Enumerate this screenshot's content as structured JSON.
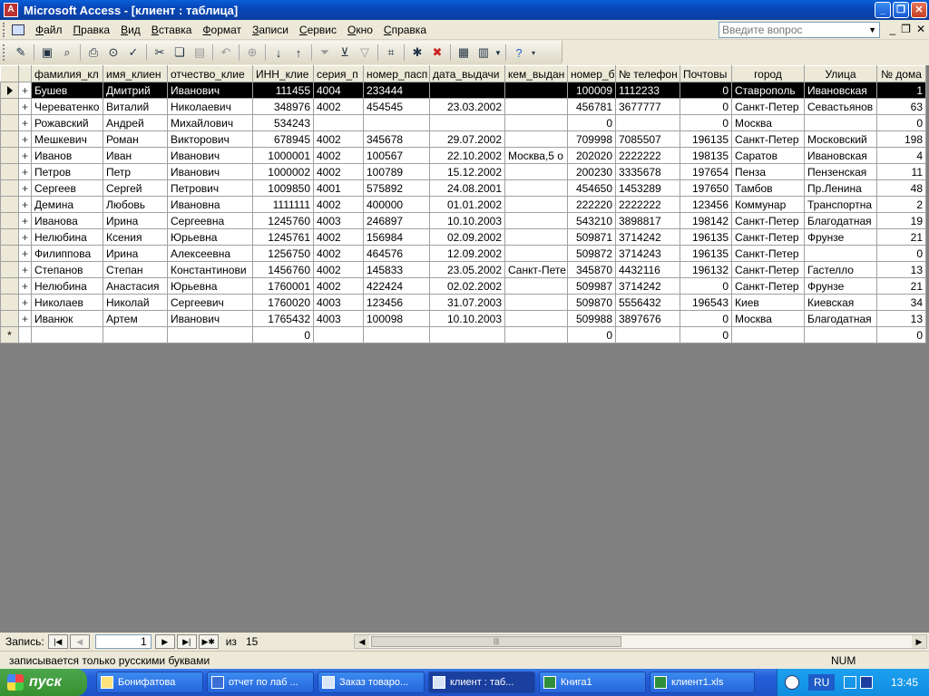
{
  "window": {
    "title": "Microsoft Access - [клиент : таблица]",
    "app_icon": "access-icon"
  },
  "menu": {
    "items": [
      "Файл",
      "Правка",
      "Вид",
      "Вставка",
      "Формат",
      "Записи",
      "Сервис",
      "Окно",
      "Справка"
    ],
    "ask_placeholder": "Введите вопрос"
  },
  "toolbar": {
    "icons": [
      "design-view-icon",
      "save-icon",
      "search-icon",
      "print-icon",
      "print-preview-icon",
      "spelling-icon",
      "cut-icon",
      "copy-icon",
      "paste-icon",
      "undo-icon",
      "hyperlink-icon",
      "sort-ascending-icon",
      "sort-descending-icon",
      "filter-by-selection-icon",
      "filter-by-form-icon",
      "apply-filter-icon",
      "find-icon",
      "new-record-icon",
      "delete-record-icon",
      "database-window-icon",
      "new-object-icon",
      "help-icon"
    ]
  },
  "table": {
    "columns": [
      "фамилия_кл",
      "имя_клиен",
      "отчество_клие",
      "ИНН_клие",
      "серия_п",
      "номер_пасп",
      "дата_выдачи",
      "кем_выдан",
      "номер_б",
      "№ телефон",
      "Почтовы",
      "город",
      "Улица",
      "№ дома"
    ],
    "rows": [
      [
        "Бушев",
        "Дмитрий",
        "Иванович",
        "111455",
        "4004",
        "233444",
        "",
        "",
        "100009",
        "1112233",
        "0",
        "Ставрополь",
        "Ивановская",
        "1"
      ],
      [
        "Череватенко",
        "Виталий",
        "Николаевич",
        "348976",
        "4002",
        "454545",
        "23.03.2002",
        "",
        "456781",
        "3677777",
        "0",
        "Санкт-Петер",
        "Севастьянов",
        "63"
      ],
      [
        "Рожавский",
        "Андрей",
        "Михайлович",
        "534243",
        "",
        "",
        "",
        "",
        "0",
        "",
        "0",
        "Москва",
        "",
        "0"
      ],
      [
        "Мешкевич",
        "Роман",
        "Викторович",
        "678945",
        "4002",
        "345678",
        "29.07.2002",
        "",
        "709998",
        "7085507",
        "196135",
        "Санкт-Петер",
        "Московский",
        "198"
      ],
      [
        "Иванов",
        "Иван",
        "Иванович",
        "1000001",
        "4002",
        "100567",
        "22.10.2002",
        "Москва,5 о",
        "202020",
        "2222222",
        "198135",
        "Саратов",
        "Ивановская",
        "4"
      ],
      [
        "Петров",
        "Петр",
        "Иванович",
        "1000002",
        "4002",
        "100789",
        "15.12.2002",
        "",
        "200230",
        "3335678",
        "197654",
        "Пенза",
        "Пензенская",
        "11"
      ],
      [
        "Сергеев",
        "Сергей",
        "Петрович",
        "1009850",
        "4001",
        "575892",
        "24.08.2001",
        "",
        "454650",
        "1453289",
        "197650",
        "Тамбов",
        "Пр.Ленина",
        "48"
      ],
      [
        "Демина",
        "Любовь",
        "Ивановна",
        "1111111",
        "4002",
        "400000",
        "01.01.2002",
        "",
        "222220",
        "2222222",
        "123456",
        "Коммунар",
        "Транспортна",
        "2"
      ],
      [
        "Иванова",
        "Ирина",
        "Сергеевна",
        "1245760",
        "4003",
        "246897",
        "10.10.2003",
        "",
        "543210",
        "3898817",
        "198142",
        "Санкт-Петер",
        "Благодатная",
        "19"
      ],
      [
        "Нелюбина",
        "Ксения",
        "Юрьевна",
        "1245761",
        "4002",
        "156984",
        "02.09.2002",
        "",
        "509871",
        "3714242",
        "196135",
        "Санкт-Петер",
        "Фрунзе",
        "21"
      ],
      [
        "Филиппова",
        "Ирина",
        "Алексеевна",
        "1256750",
        "4002",
        "464576",
        "12.09.2002",
        "",
        "509872",
        "3714243",
        "196135",
        "Санкт-Петер",
        "",
        "0"
      ],
      [
        "Степанов",
        "Степан",
        "Константинови",
        "1456760",
        "4002",
        "145833",
        "23.05.2002",
        "Санкт-Пете",
        "345870",
        "4432116",
        "196132",
        "Санкт-Петер",
        "Гастелло",
        "13"
      ],
      [
        "Нелюбина",
        "Анастасия",
        "Юрьевна",
        "1760001",
        "4002",
        "422424",
        "02.02.2002",
        "",
        "509987",
        "3714242",
        "0",
        "Санкт-Петер",
        "Фрунзе",
        "21"
      ],
      [
        "Николаев",
        "Николай",
        "Сергеевич",
        "1760020",
        "4003",
        "123456",
        "31.07.2003",
        "",
        "509870",
        "5556432",
        "196543",
        "Киев",
        "Киевская",
        "34"
      ],
      [
        "Иванюк",
        "Артем",
        "Иванович",
        "1765432",
        "4003",
        "100098",
        "10.10.2003",
        "",
        "509988",
        "3897676",
        "0",
        "Москва",
        "Благодатная",
        "13"
      ]
    ],
    "new_row": [
      "",
      "",
      "",
      "0",
      "",
      "",
      "",
      "",
      "0",
      "",
      "0",
      "",
      "",
      "0"
    ],
    "new_row_marker": "*"
  },
  "navigation": {
    "label": "Запись:",
    "current": "1",
    "of_label": "из",
    "total": "15"
  },
  "status": {
    "message": "записывается только русскими буквами",
    "num": "NUM"
  },
  "taskbar": {
    "start_label": "пуск",
    "tasks": [
      {
        "label": "Бонифатова",
        "icon": "folder-icon"
      },
      {
        "label": "отчет по лаб ...",
        "icon": "word-icon"
      },
      {
        "label": "Заказ товаро...",
        "icon": "table-icon"
      },
      {
        "label": "клиент : таб...",
        "icon": "table-icon"
      },
      {
        "label": "Книга1",
        "icon": "excel-icon"
      },
      {
        "label": "клиент1.xls",
        "icon": "excel-icon"
      }
    ],
    "lang": "RU",
    "clock": "13:45"
  }
}
